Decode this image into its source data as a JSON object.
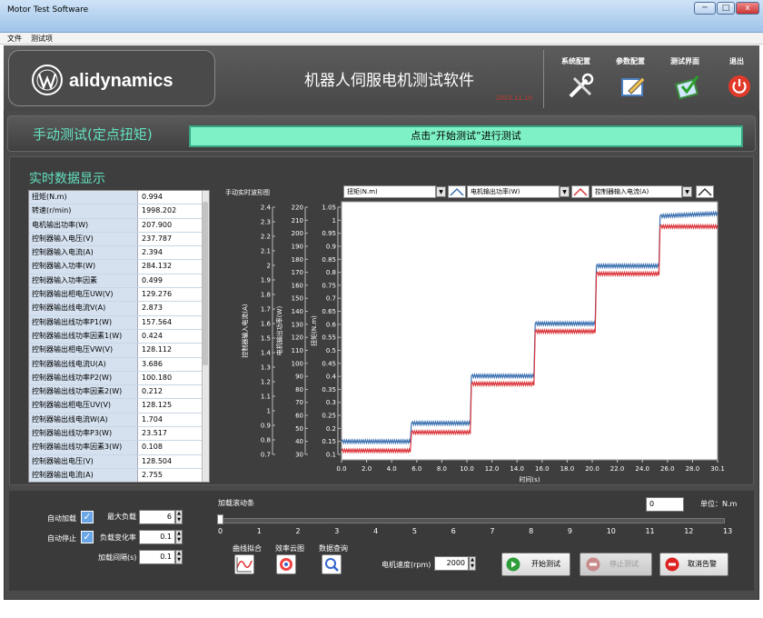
{
  "window": {
    "title": "Motor Test Software",
    "buttons": [
      "─",
      "□",
      "x"
    ]
  },
  "menu": [
    "文件",
    "测试项"
  ],
  "header": {
    "logo": "alidynamics",
    "title": "机器人伺服电机测试软件",
    "version": "2023.11.10"
  },
  "nav": [
    {
      "label": "系统配置",
      "icon": "tools-icon"
    },
    {
      "label": "参数配置",
      "icon": "edit-icon"
    },
    {
      "label": "测试界面",
      "icon": "test-icon"
    },
    {
      "label": "退出",
      "icon": "power-icon"
    }
  ],
  "mode_title": "手动测试(定点扭矩)",
  "status": "点击“开始测试”进行测试",
  "realtime": {
    "title": "实时数据显示",
    "rows": [
      {
        "k": "扭矩(N.m)",
        "v": "0.994"
      },
      {
        "k": "转速(r/min)",
        "v": "1998.202"
      },
      {
        "k": "电机输出功率(W)",
        "v": "207.900"
      },
      {
        "k": "控制器输入电压(V)",
        "v": "237.787"
      },
      {
        "k": "控制器输入电流(A)",
        "v": "2.394"
      },
      {
        "k": "控制器输入功率(W)",
        "v": "284.132"
      },
      {
        "k": "控制器输入功率因素",
        "v": "0.499"
      },
      {
        "k": "控制器输出相电压UW(V)",
        "v": "129.276"
      },
      {
        "k": "控制器输出线电流V(A)",
        "v": "2.873"
      },
      {
        "k": "控制器输出线功率P1(W)",
        "v": "157.564"
      },
      {
        "k": "控制器输出线功率因素1(W)",
        "v": "0.424"
      },
      {
        "k": "控制器输出相电压VW(V)",
        "v": "128.112"
      },
      {
        "k": "控制器输出线电流U(A)",
        "v": "3.686"
      },
      {
        "k": "控制器输出线功率P2(W)",
        "v": "100.180"
      },
      {
        "k": "控制器输出线功率因素2(W)",
        "v": "0.212"
      },
      {
        "k": "控制器输出相电压UV(V)",
        "v": "128.125"
      },
      {
        "k": "控制器输出线电流W(A)",
        "v": "1.704"
      },
      {
        "k": "控制器输出线功率P3(W)",
        "v": "23.517"
      },
      {
        "k": "控制器输出线功率因素3(W)",
        "v": "0.108"
      },
      {
        "k": "控制器输出电压(V)",
        "v": "128.504"
      },
      {
        "k": "控制器输出电流(A)",
        "v": "2.755"
      }
    ]
  },
  "chart_data": {
    "type": "line",
    "caption": "手动实时波形图",
    "selectors": [
      "扭矩(N.m)",
      "电机输出功率(W)",
      "控制器输入电流(A)"
    ],
    "xlabel": "时间(s)",
    "xlim": [
      0,
      30.1
    ],
    "xticks": [
      "0.0",
      "2.0",
      "4.0",
      "6.0",
      "8.0",
      "10.0",
      "12.0",
      "14.0",
      "16.0",
      "18.0",
      "20.0",
      "22.0",
      "24.0",
      "26.0",
      "28.0",
      "30.1"
    ],
    "axes": [
      {
        "label": "控制器输入电流(A)",
        "ticks": [
          "2.4",
          "2.3",
          "2.2",
          "2.1",
          "2",
          "1.9",
          "1.8",
          "1.7",
          "1.6",
          "1.5",
          "1.4",
          "1.3",
          "1.2",
          "1.1",
          "1",
          "0.9",
          "0.8",
          "0.7"
        ]
      },
      {
        "label": "电机输出功率(W)",
        "ticks": [
          "220",
          "210",
          "200",
          "190",
          "180",
          "170",
          "160",
          "150",
          "140",
          "130",
          "120",
          "110",
          "100",
          "90",
          "80",
          "70",
          "60",
          "50",
          "40",
          "30"
        ]
      },
      {
        "label": "扭矩(N.m)",
        "ticks": [
          "1.05",
          "1",
          "0.95",
          "0.9",
          "0.85",
          "0.8",
          "0.75",
          "0.7",
          "0.65",
          "0.6",
          "0.55",
          "0.5",
          "0.45",
          "0.4",
          "0.35",
          "0.3",
          "0.25",
          "0.2",
          "0.15",
          "0.1"
        ]
      }
    ],
    "ylim": [
      0.1,
      1.05
    ],
    "series": [
      {
        "color": "#3a6fb0",
        "x": [
          0,
          5.5,
          5.6,
          10.3,
          10.4,
          15.4,
          15.5,
          20.3,
          20.4,
          25.4,
          25.5,
          30.1
        ],
        "y": [
          0.17,
          0.17,
          0.24,
          0.24,
          0.42,
          0.42,
          0.62,
          0.62,
          0.84,
          0.84,
          1.03,
          1.04
        ]
      },
      {
        "color": "#d9343a",
        "x": [
          0,
          5.5,
          5.6,
          10.3,
          10.4,
          15.4,
          15.5,
          20.3,
          20.4,
          25.4,
          25.5,
          30.1
        ],
        "y": [
          0.135,
          0.135,
          0.205,
          0.205,
          0.39,
          0.39,
          0.59,
          0.59,
          0.81,
          0.81,
          0.99,
          0.99
        ]
      }
    ]
  },
  "controls": {
    "auto_load": "自动加载",
    "max_load": "最大负载",
    "max_load_val": "6",
    "auto_stop": "自动停止",
    "load_rate": "负载变化率",
    "load_rate_val": "0.1",
    "load_interval": "加载间隔(s)",
    "load_interval_val": "0.1",
    "slider_title": "加载滚动条",
    "slider_value": "0",
    "slider_ticks": [
      "0",
      "1",
      "2",
      "3",
      "4",
      "5",
      "6",
      "7",
      "8",
      "9",
      "10",
      "11",
      "12",
      "13"
    ],
    "unit": "单位：N.m",
    "tools": [
      "曲线拟合",
      "效率云图",
      "数据查询"
    ],
    "speed_label": "电机速度(rpm)",
    "speed_val": "2000",
    "start": "开始测试",
    "stop": "停止测试",
    "cancel_alarm": "取消告警"
  }
}
